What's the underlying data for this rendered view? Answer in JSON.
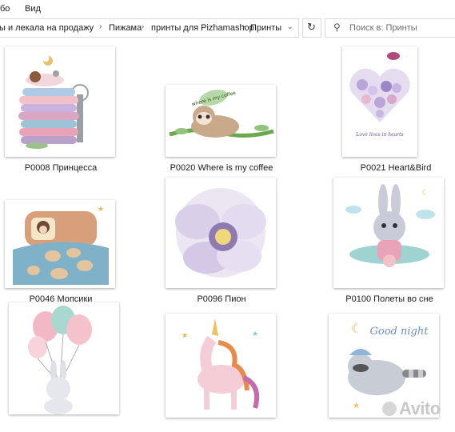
{
  "menu": {
    "item1": "ебо",
    "item2": "Вид"
  },
  "breadcrumb": {
    "items": [
      "ы и лекала на продажу",
      "Пижама",
      "принты для Pizhamashop",
      "Принты"
    ],
    "separator": "›",
    "dropdown": "⌄"
  },
  "refresh_icon": "refresh-icon",
  "search": {
    "placeholder": "Поиск в: Принты",
    "icon": "search-icon"
  },
  "files": [
    {
      "name": "P0008 Принцесса"
    },
    {
      "name": "P0020 Where is my coffee"
    },
    {
      "name": "P0021 Heart&Bird"
    },
    {
      "name": "P0046 Мопсики"
    },
    {
      "name": "P0096 Пион"
    },
    {
      "name": "P0100 Полеты во сне"
    },
    {
      "name": ""
    },
    {
      "name": ""
    },
    {
      "name": ""
    }
  ],
  "art": {
    "sloth_text": "where is my coffee",
    "heart_text": "Love lives in hearts",
    "goodnight_text": "Good night"
  },
  "watermark": {
    "text": "Avito",
    "logo": "avito-logo-icon"
  },
  "colors": {
    "border": "#d9d9d9",
    "accent_pink": "#e8a3b8",
    "accent_blue": "#6a8fc9"
  }
}
